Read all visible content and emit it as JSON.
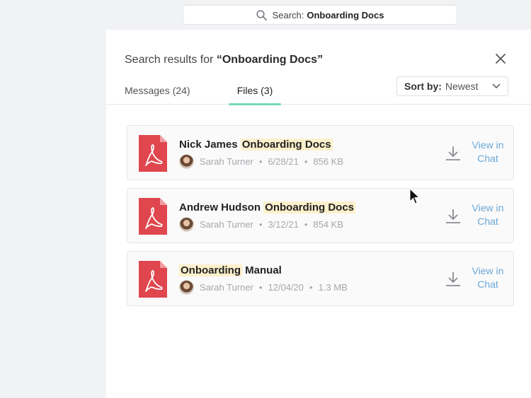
{
  "search": {
    "prefix": "Search:",
    "query": "Onboarding Docs"
  },
  "panel": {
    "title_prefix": "Search results for",
    "title_query": "“Onboarding Docs”",
    "tabs": [
      {
        "label": "Messages (24)"
      },
      {
        "label": "Files (3)"
      }
    ],
    "sort": {
      "label": "Sort by:",
      "value": "Newest"
    }
  },
  "files": [
    {
      "name_pre": "Nick James ",
      "name_hl": "Onboarding Docs",
      "name_post": "",
      "author": "Sarah Turner",
      "date": "6/28/21",
      "size": "856 KB",
      "action": "View in Chat"
    },
    {
      "name_pre": "Andrew Hudson ",
      "name_hl": "Onboarding Docs",
      "name_post": "",
      "author": "Sarah Turner",
      "date": "3/12/21",
      "size": "854 KB",
      "action": "View in Chat"
    },
    {
      "name_pre": "",
      "name_hl": "Onboarding",
      "name_post": " Manual",
      "author": "Sarah Turner",
      "date": "12/04/20",
      "size": "1.3 MB",
      "action": "View in Chat"
    }
  ],
  "separator": "•",
  "icons": {
    "search": "search-icon",
    "close": "close-icon",
    "chevron": "chevron-down-icon",
    "pdf": "pdf-file-icon",
    "download": "download-icon",
    "cursor": "mouse-pointer-icon"
  },
  "colors": {
    "accent_tab": "#74d9b6",
    "link": "#6aa8d8",
    "pdf": "#e0464e",
    "highlight": "#fdf0cc"
  }
}
